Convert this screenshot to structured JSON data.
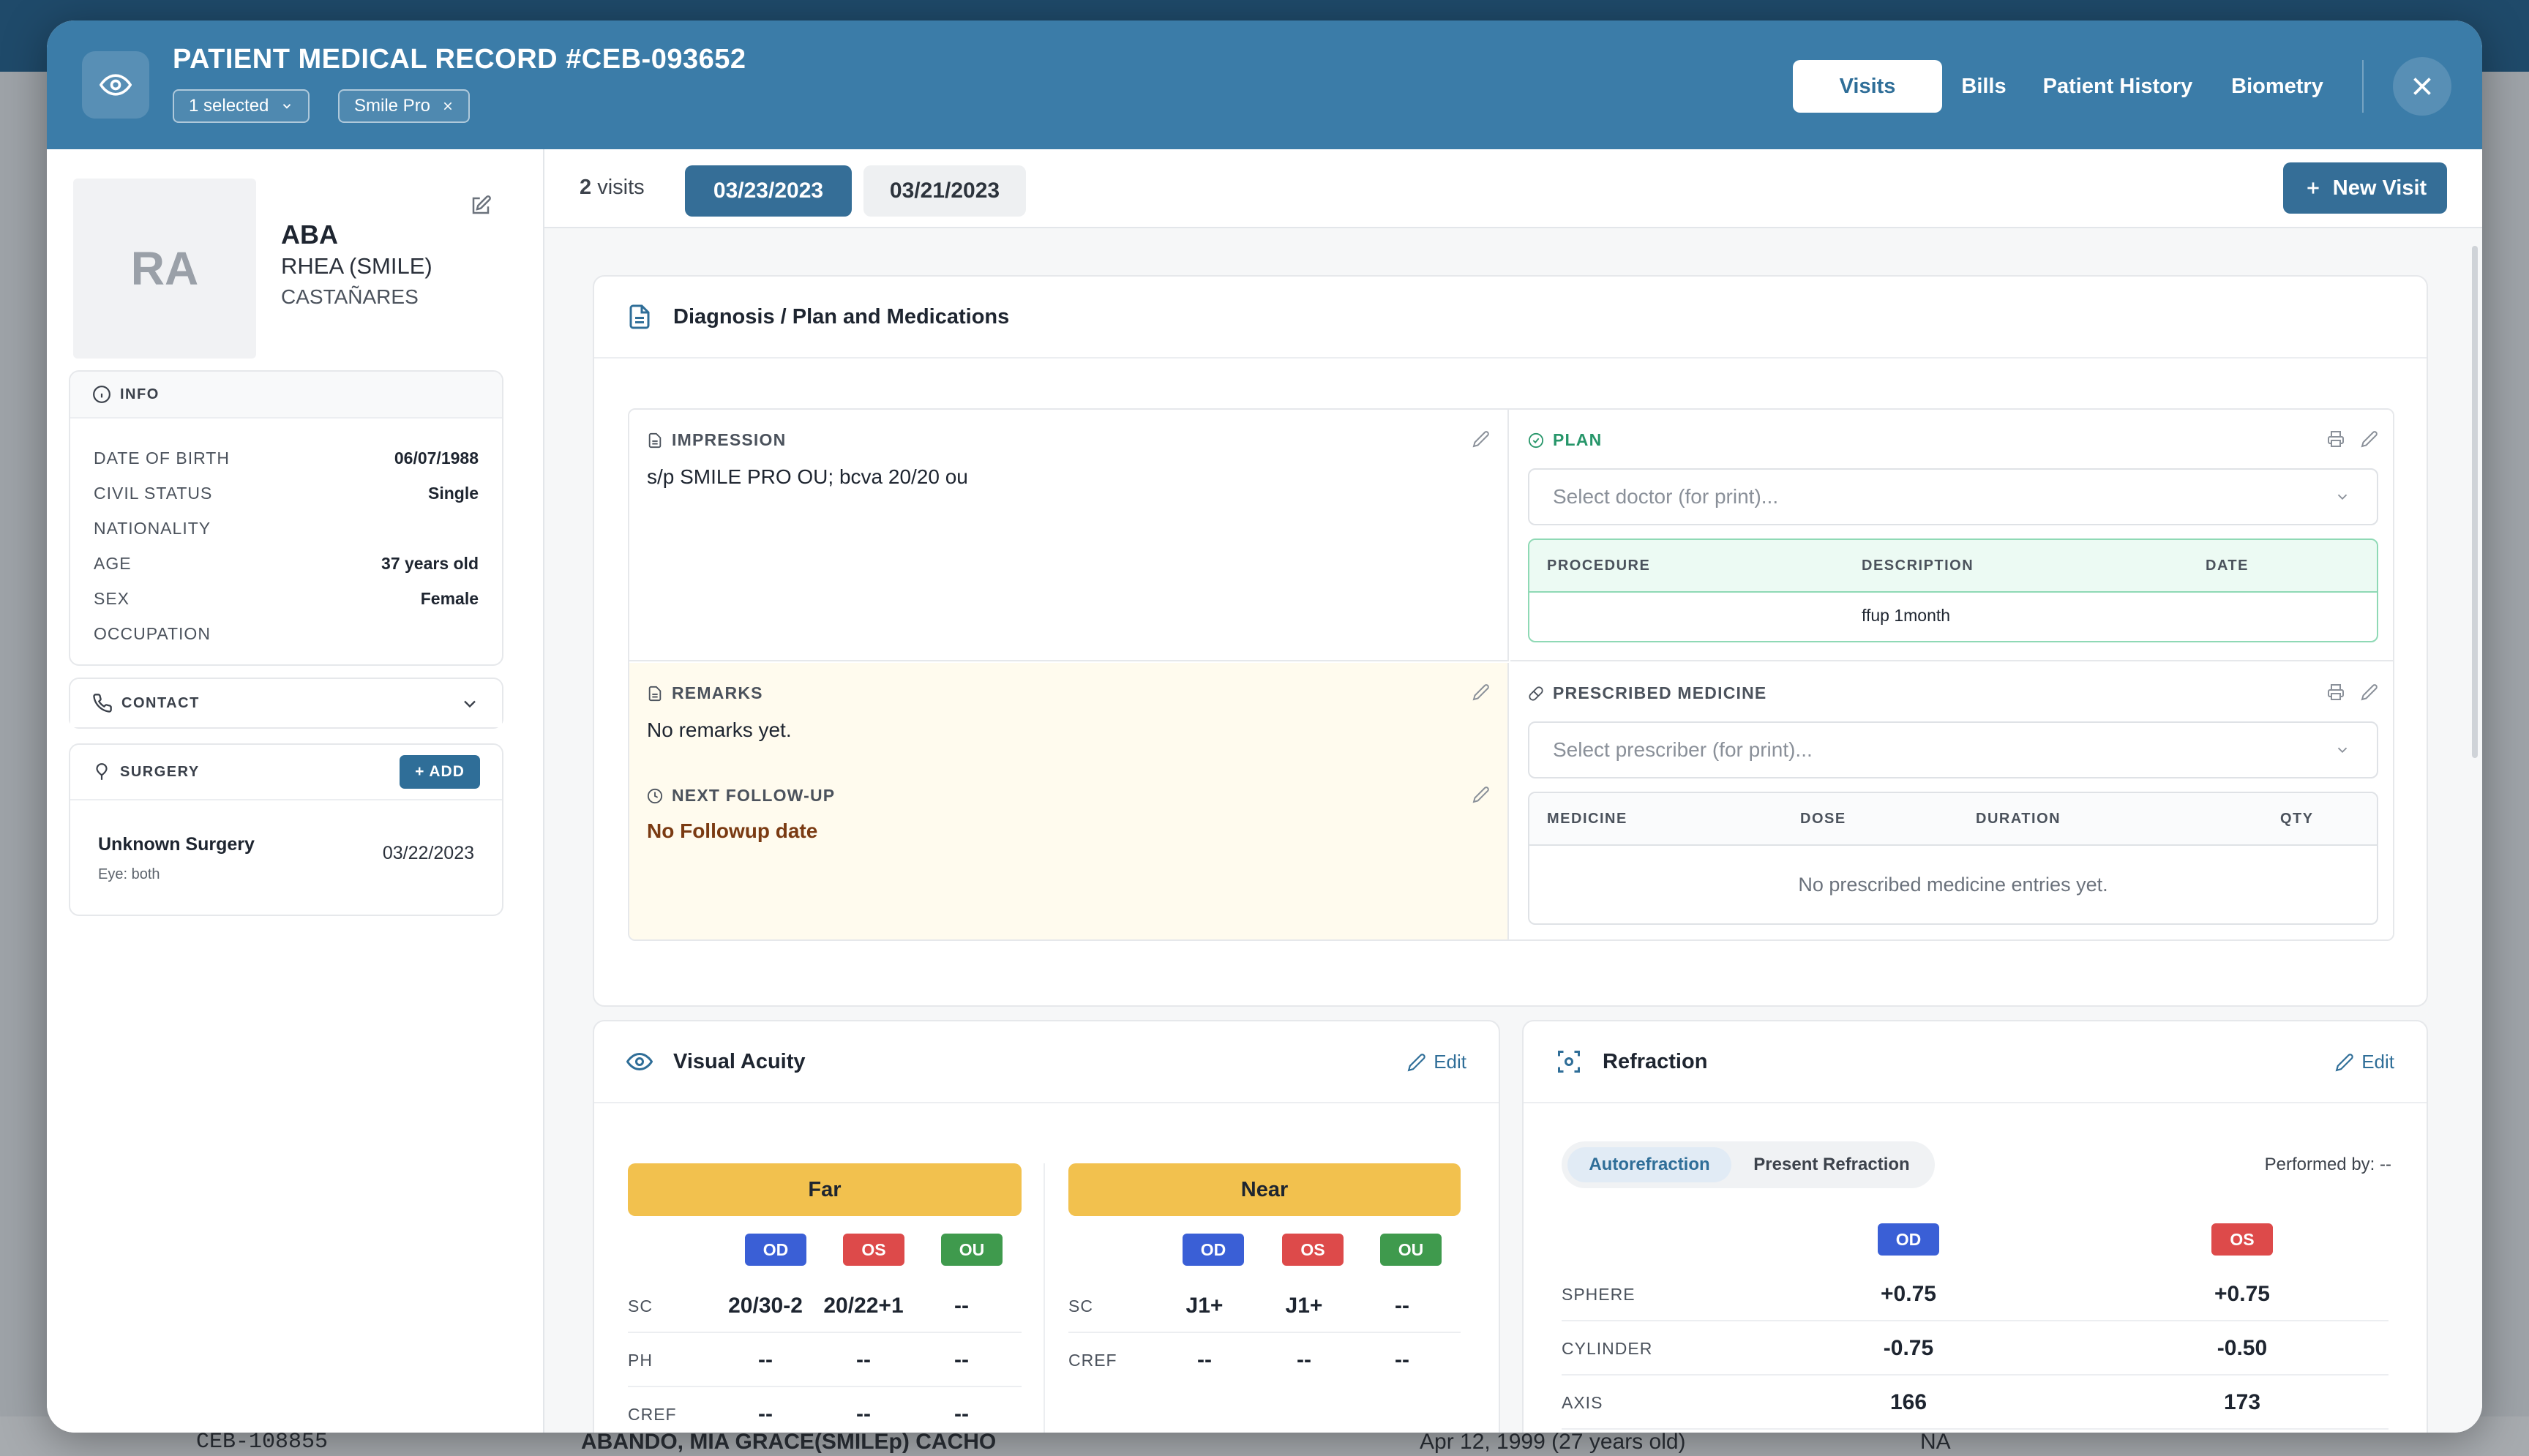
{
  "header": {
    "title": "PATIENT MEDICAL RECORD #CEB-093652",
    "selected_chip": "1 selected",
    "filter_chip": "Smile Pro",
    "tabs": [
      "Visits",
      "Bills",
      "Patient History",
      "Biometry"
    ]
  },
  "patient": {
    "initials": "RA",
    "last_name": "ABA",
    "first_name": "RHEA (SMILE)",
    "middle_name": "CASTAÑARES"
  },
  "info": {
    "title": "INFO",
    "rows": [
      {
        "label": "DATE OF BIRTH",
        "value": "06/07/1988"
      },
      {
        "label": "CIVIL STATUS",
        "value": "Single"
      },
      {
        "label": "NATIONALITY",
        "value": ""
      },
      {
        "label": "AGE",
        "value": "37 years old"
      },
      {
        "label": "SEX",
        "value": "Female"
      },
      {
        "label": "OCCUPATION",
        "value": ""
      }
    ]
  },
  "contact": {
    "title": "CONTACT"
  },
  "surgery": {
    "title": "SURGERY",
    "add_label": "ADD",
    "name": "Unknown Surgery",
    "eye": "Eye: both",
    "date": "03/22/2023"
  },
  "visits": {
    "count": "2",
    "count_label": "visits",
    "dates": [
      "03/23/2023",
      "03/21/2023"
    ],
    "new_visit": "New Visit"
  },
  "diagnosis": {
    "title": "Diagnosis / Plan and Medications",
    "impression": {
      "title": "IMPRESSION",
      "text": "s/p SMILE PRO OU; bcva 20/20 ou"
    },
    "plan": {
      "title": "PLAN",
      "select_placeholder": "Select doctor (for print)...",
      "columns": [
        "PROCEDURE",
        "DESCRIPTION",
        "DATE"
      ],
      "rows": [
        {
          "procedure": "",
          "description": "ffup 1month",
          "date": ""
        }
      ]
    },
    "remarks": {
      "title": "REMARKS",
      "text": "No remarks yet."
    },
    "followup": {
      "title": "NEXT FOLLOW-UP",
      "text": "No Followup date"
    },
    "medicine": {
      "title": "PRESCRIBED MEDICINE",
      "select_placeholder": "Select prescriber (for print)...",
      "columns": [
        "MEDICINE",
        "DOSE",
        "DURATION",
        "QTY"
      ],
      "empty": "No prescribed medicine entries yet."
    }
  },
  "visual_acuity": {
    "title": "Visual Acuity",
    "edit": "Edit",
    "far": {
      "label": "Far",
      "eyes": [
        "OD",
        "OS",
        "OU"
      ],
      "rows": [
        {
          "label": "SC",
          "od": "20/30-2",
          "os": "20/22+1",
          "ou": "--"
        },
        {
          "label": "PH",
          "od": "--",
          "os": "--",
          "ou": "--"
        },
        {
          "label": "CREF",
          "od": "--",
          "os": "--",
          "ou": "--"
        }
      ]
    },
    "near": {
      "label": "Near",
      "eyes": [
        "OD",
        "OS",
        "OU"
      ],
      "rows": [
        {
          "label": "SC",
          "od": "J1+",
          "os": "J1+",
          "ou": "--"
        },
        {
          "label": "CREF",
          "od": "--",
          "os": "--",
          "ou": "--"
        }
      ]
    }
  },
  "refraction": {
    "title": "Refraction",
    "edit": "Edit",
    "tabs": [
      "Autorefraction",
      "Present Refraction"
    ],
    "performed_by": "Performed by: --",
    "eyes": [
      "OD",
      "OS"
    ],
    "rows": [
      {
        "label": "SPHERE",
        "od": "+0.75",
        "os": "+0.75"
      },
      {
        "label": "CYLINDER",
        "od": "-0.75",
        "os": "-0.50"
      },
      {
        "label": "AXIS",
        "od": "166",
        "os": "173"
      }
    ]
  },
  "background": {
    "row_id": "CEB-108855",
    "row_name": "ABANDO, MIA GRACE(SMILEp) CACHO",
    "row_dob": "Apr 12, 1999 (27 years old)",
    "row_na": "NA"
  },
  "colors": {
    "header": "#3b7ca8",
    "primary": "#356e97",
    "far_near": "#f2c14e",
    "od": "#3a5fd6",
    "os": "#dd4a4a",
    "ou": "#3f9a4d",
    "plan_green": "#27966a"
  }
}
